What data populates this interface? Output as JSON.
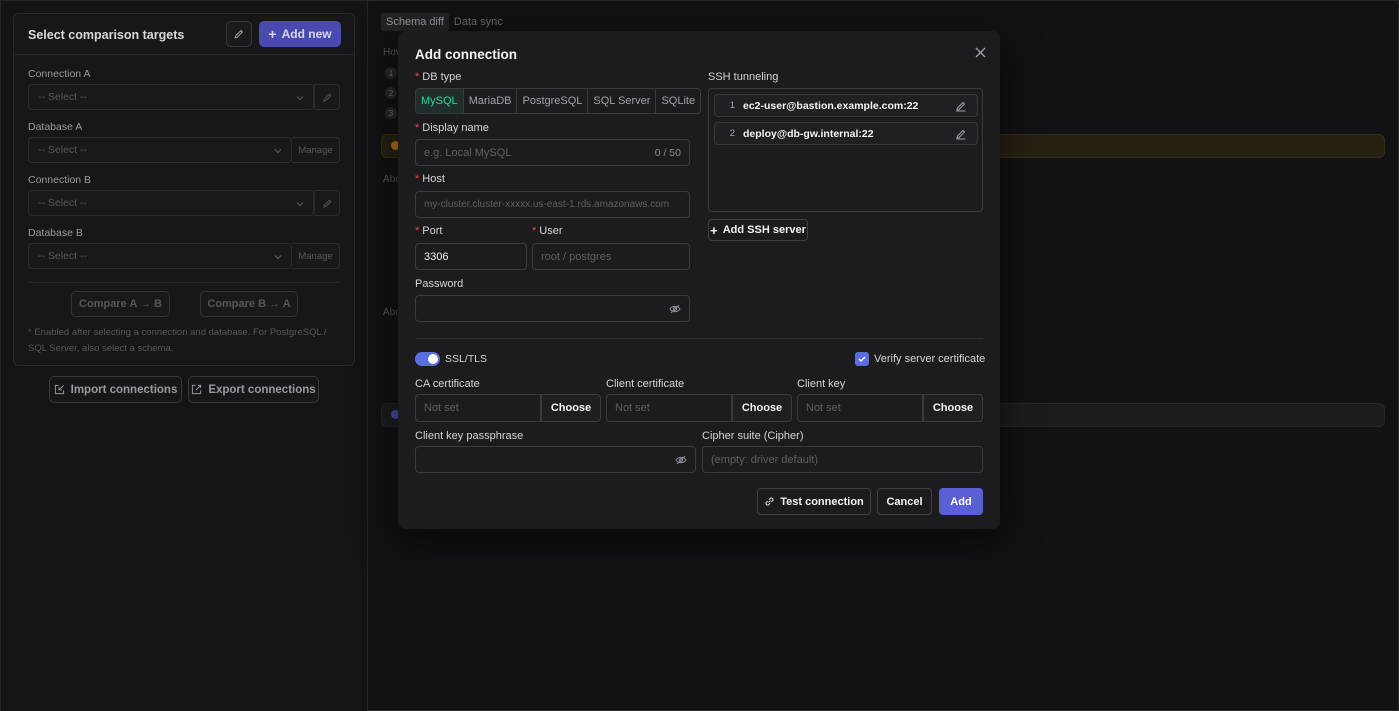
{
  "sidebar": {
    "title": "Select comparison targets",
    "add_new": "Add new",
    "connection_a_label": "Connection A",
    "database_a_label": "Database A",
    "connection_b_label": "Connection B",
    "database_b_label": "Database B",
    "select_placeholder": "-- Select --",
    "manage": "Manage",
    "compare_a_b": "Compare A → B",
    "compare_b_a": "Compare B → A",
    "note": "* Enabled after selecting a connection and database. For PostgreSQL / SQL Server, also select a schema.",
    "import": "Import connections",
    "export": "Export connections"
  },
  "background": {
    "tabs": [
      "Schema diff",
      "Data sync"
    ],
    "frag_how": "Hov",
    "frag_about1": "Abc",
    "frag_about2": "Abc",
    "steps": [
      "1",
      "2",
      "3"
    ]
  },
  "modal": {
    "title": "Add connection",
    "db_type_label": "DB type",
    "db_types": [
      "MySQL",
      "MariaDB",
      "PostgreSQL",
      "SQL Server",
      "SQLite"
    ],
    "db_type_selected": "MySQL",
    "display_name_label": "Display name",
    "display_name_placeholder": "e.g. Local MySQL",
    "display_name_counter": "0 / 50",
    "host_label": "Host",
    "host_placeholder": "my-cluster.cluster-xxxxx.us-east-1.rds.amazonaws.com",
    "port_label": "Port",
    "port_value": "3306",
    "user_label": "User",
    "user_placeholder": "root / postgres",
    "password_label": "Password",
    "ssh_label": "SSH tunneling",
    "ssh_servers": [
      {
        "index": "1",
        "host": "ec2-user@bastion.example.com:22"
      },
      {
        "index": "2",
        "host": "deploy@db-gw.internal:22"
      }
    ],
    "add_ssh": "Add SSH server",
    "ssl_label": "SSL/TLS",
    "ssl_enabled": true,
    "verify_label": "Verify server certificate",
    "verify_checked": true,
    "ca_label": "CA certificate",
    "client_cert_label": "Client certificate",
    "client_key_label": "Client key",
    "not_set": "Not set",
    "choose": "Choose",
    "passphrase_label": "Client key passphrase",
    "cipher_label": "Cipher suite (Cipher)",
    "cipher_placeholder": "(empty: driver default)",
    "test_connection": "Test connection",
    "cancel": "Cancel",
    "add": "Add"
  },
  "colors": {
    "primary": "#5b5fd6",
    "accent_green": "#34d399",
    "required": "#ef4444"
  }
}
